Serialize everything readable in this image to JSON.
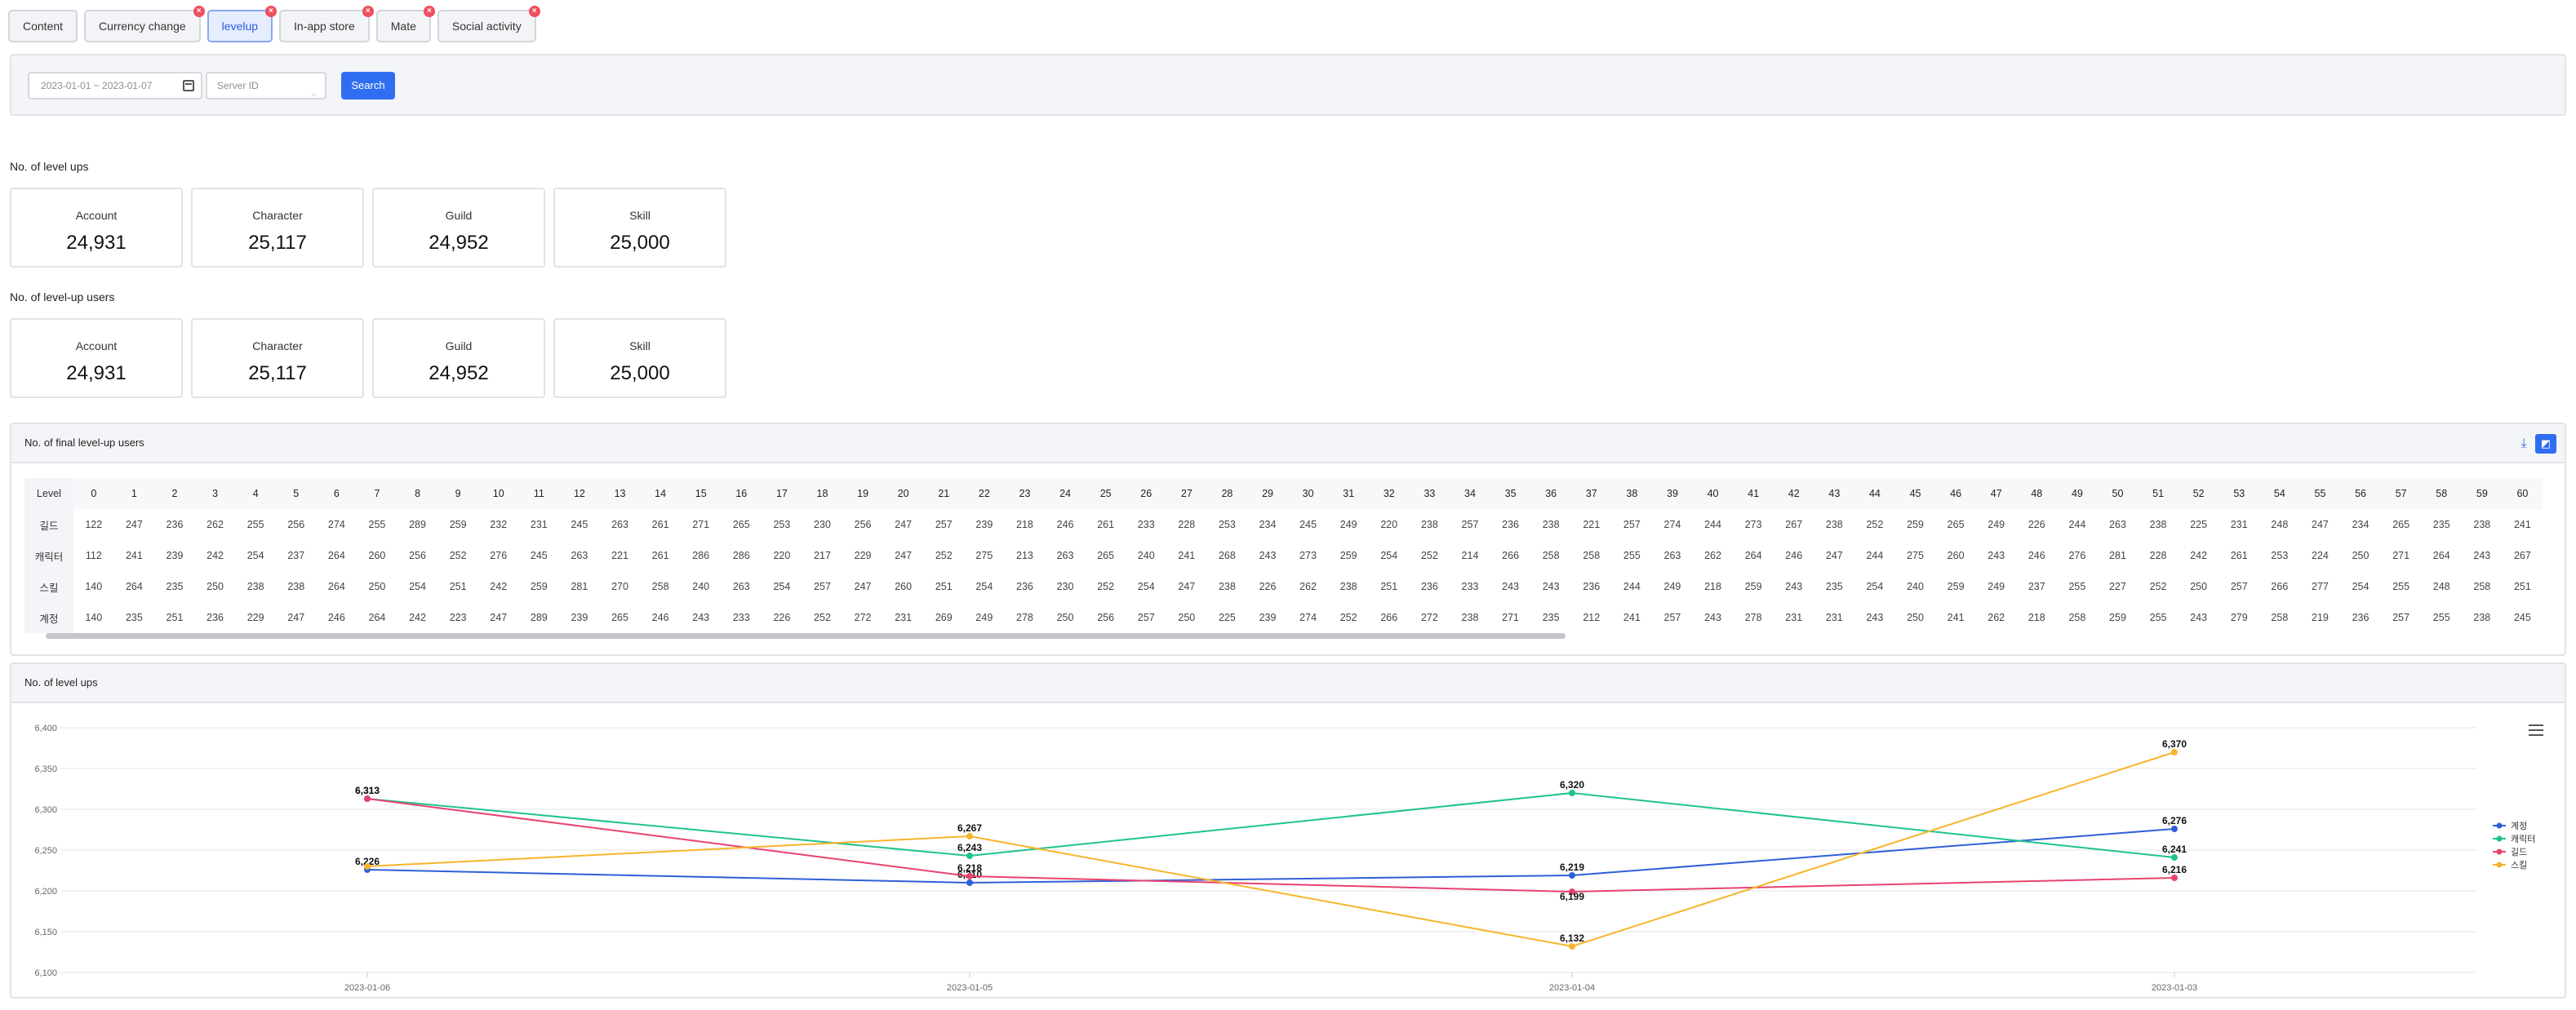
{
  "tabs": [
    {
      "label": "Content",
      "active": false,
      "closable": false
    },
    {
      "label": "Currency change",
      "active": false,
      "closable": true
    },
    {
      "label": "levelup",
      "active": true,
      "closable": true
    },
    {
      "label": "In-app store",
      "active": false,
      "closable": true
    },
    {
      "label": "Mate",
      "active": false,
      "closable": true
    },
    {
      "label": "Social activity",
      "active": false,
      "closable": true
    }
  ],
  "filter": {
    "date_range": "2023-01-01 ~ 2023-01-07",
    "server_placeholder": "Server ID",
    "search_label": "Search"
  },
  "levelups": {
    "title": "No. of level ups",
    "cards": [
      {
        "label": "Account",
        "value": "24,931"
      },
      {
        "label": "Character",
        "value": "25,117"
      },
      {
        "label": "Guild",
        "value": "24,952"
      },
      {
        "label": "Skill",
        "value": "25,000"
      }
    ]
  },
  "levelup_users": {
    "title": "No. of level-up users",
    "cards": [
      {
        "label": "Account",
        "value": "24,931"
      },
      {
        "label": "Character",
        "value": "25,117"
      },
      {
        "label": "Guild",
        "value": "24,952"
      },
      {
        "label": "Skill",
        "value": "25,000"
      }
    ]
  },
  "final_table": {
    "title": "No. of final level-up users",
    "header_label": "Level",
    "levels": [
      0,
      1,
      2,
      3,
      4,
      5,
      6,
      7,
      8,
      9,
      10,
      11,
      12,
      13,
      14,
      15,
      16,
      17,
      18,
      19,
      20,
      21,
      22,
      23,
      24,
      25,
      26,
      27,
      28,
      29,
      30,
      31,
      32,
      33,
      34,
      35,
      36,
      37,
      38,
      39,
      40,
      41,
      42,
      43,
      44,
      45,
      46,
      47,
      48,
      49,
      50,
      51,
      52,
      53,
      54,
      55,
      56,
      57,
      58,
      59,
      60
    ],
    "rows": [
      {
        "label": "길드",
        "values": [
          122,
          247,
          236,
          262,
          255,
          256,
          274,
          255,
          289,
          259,
          232,
          231,
          245,
          263,
          261,
          271,
          265,
          253,
          230,
          256,
          247,
          257,
          239,
          218,
          246,
          261,
          233,
          228,
          253,
          234,
          245,
          249,
          220,
          238,
          257,
          236,
          238,
          221,
          257,
          274,
          244,
          273,
          267,
          238,
          252,
          259,
          265,
          249,
          226,
          244,
          263,
          238,
          225,
          231,
          248,
          247,
          234,
          265,
          235,
          238,
          241
        ]
      },
      {
        "label": "캐릭터",
        "values": [
          112,
          241,
          239,
          242,
          254,
          237,
          264,
          260,
          256,
          252,
          276,
          245,
          263,
          221,
          261,
          286,
          286,
          220,
          217,
          229,
          247,
          252,
          275,
          213,
          263,
          265,
          240,
          241,
          268,
          243,
          273,
          259,
          254,
          252,
          214,
          266,
          258,
          258,
          255,
          263,
          262,
          264,
          246,
          247,
          244,
          275,
          260,
          243,
          246,
          276,
          281,
          228,
          242,
          261,
          253,
          224,
          250,
          271,
          264,
          243,
          267
        ]
      },
      {
        "label": "스킬",
        "values": [
          140,
          264,
          235,
          250,
          238,
          238,
          264,
          250,
          254,
          251,
          242,
          259,
          281,
          270,
          258,
          240,
          263,
          254,
          257,
          247,
          260,
          251,
          254,
          236,
          230,
          252,
          254,
          247,
          238,
          226,
          262,
          238,
          251,
          236,
          233,
          243,
          243,
          236,
          244,
          249,
          218,
          259,
          243,
          235,
          254,
          240,
          259,
          249,
          237,
          255,
          227,
          252,
          250,
          257,
          266,
          277,
          254,
          255,
          248,
          258,
          251
        ]
      },
      {
        "label": "계정",
        "values": [
          140,
          235,
          251,
          236,
          229,
          247,
          246,
          264,
          242,
          223,
          247,
          289,
          239,
          265,
          246,
          243,
          233,
          226,
          252,
          272,
          231,
          269,
          249,
          278,
          250,
          256,
          257,
          250,
          225,
          239,
          274,
          252,
          266,
          272,
          238,
          271,
          235,
          212,
          241,
          257,
          243,
          278,
          231,
          231,
          243,
          250,
          241,
          262,
          218,
          258,
          259,
          255,
          243,
          279,
          258,
          219,
          236,
          257,
          255,
          238,
          245
        ]
      }
    ]
  },
  "chart_panel": {
    "title": "No. of level ups"
  },
  "chart_data": {
    "type": "line",
    "x": [
      "2023-01-06",
      "2023-01-05",
      "2023-01-04",
      "2023-01-03"
    ],
    "ylim": [
      6100,
      6400
    ],
    "yticks": [
      6100,
      6150,
      6200,
      6250,
      6300,
      6350,
      6400
    ],
    "ytick_labels": [
      "6,100",
      "6,150",
      "6,200",
      "6,250",
      "6,300",
      "6,350",
      "6,400"
    ],
    "grid": true,
    "legend_position": "right",
    "series": [
      {
        "name": "계정",
        "color": "#2f5fd8",
        "values": [
          6226,
          6210,
          6219,
          6276
        ],
        "labels": [
          "6,226",
          "6,210",
          "6,219",
          "6,276"
        ]
      },
      {
        "name": "캐릭터",
        "color": "#1fc38b",
        "values": [
          6313,
          6243,
          6320,
          6241
        ],
        "labels": [
          "6,313",
          "6,243",
          "6,320",
          "6,241"
        ]
      },
      {
        "name": "길드",
        "color": "#e8436f",
        "values": [
          6313,
          6218,
          6199,
          6216
        ],
        "labels": [
          "6,313",
          "6,218",
          "6,199",
          "6,216"
        ]
      },
      {
        "name": "스킬",
        "color": "#f6b52b",
        "values": [
          6230,
          6267,
          6132,
          6370
        ],
        "labels": [
          "",
          "6,267",
          "6,132",
          "6,370"
        ]
      }
    ]
  }
}
